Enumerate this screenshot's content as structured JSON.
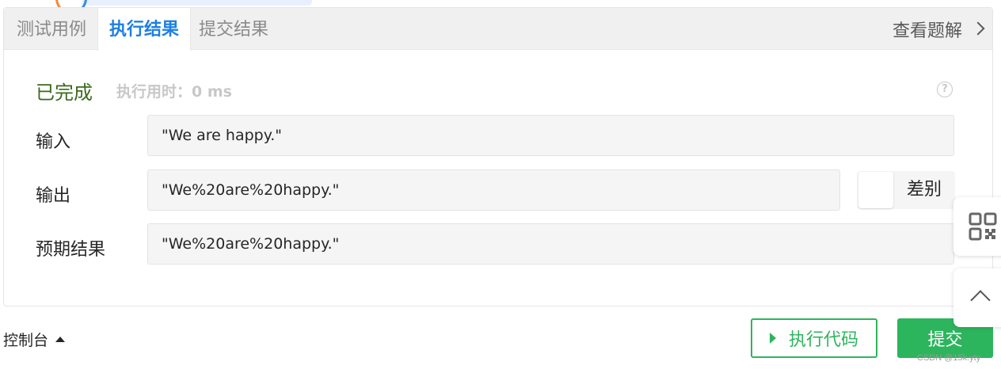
{
  "tabs": [
    {
      "label": "测试用例"
    },
    {
      "label": "执行结果"
    },
    {
      "label": "提交结果"
    }
  ],
  "active_tab": "执行结果",
  "view_solution": "查看题解",
  "result": {
    "status": "已完成",
    "runtime": "执行用时：0 ms"
  },
  "rows": {
    "input": {
      "label": "输入",
      "value": "\"We are happy.\""
    },
    "output": {
      "label": "输出",
      "value": "\"We%20are%20happy.\""
    },
    "expected": {
      "label": "预期结果",
      "value": "\"We%20are%20happy.\""
    }
  },
  "diff_toggle": {
    "label": "差别"
  },
  "footer": {
    "console_label": "控制台",
    "run_label": "执行代码",
    "submit_label": "提交"
  },
  "watermark": "CSDN @15k.yty",
  "colors": {
    "accent_blue": "#1e7fe4",
    "success_green": "#2db55d",
    "status_green": "#3a6b1c"
  },
  "icons": [
    "chevron-right-icon",
    "help-circle-icon",
    "caret-up-icon",
    "play-icon",
    "qr-code-icon",
    "back-to-top-icon"
  ]
}
